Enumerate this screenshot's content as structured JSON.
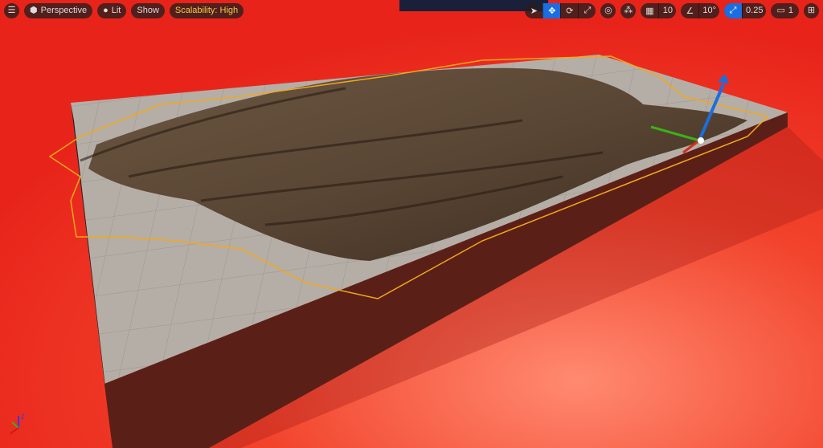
{
  "viewport": {
    "left_toolbar": {
      "menu_icon": "hamburger-icon",
      "view_mode": "Perspective",
      "lighting": "Lit",
      "show": "Show",
      "scalability": "Scalability: High"
    },
    "right_toolbar": {
      "tools": [
        "select-icon",
        "translate-icon",
        "rotate-icon",
        "scale-icon"
      ],
      "active_tool": "translate-icon",
      "grid_snap": "10",
      "rotation_snap": "10°",
      "scale_snap": "0.25",
      "camera_speed": "1"
    },
    "axis_labels": {
      "x": "X",
      "y": "Y",
      "z": "Z"
    },
    "colors": {
      "background": "#e8281a",
      "accent": "#1a6ee0",
      "selection_outline": "#f2a81a"
    }
  }
}
